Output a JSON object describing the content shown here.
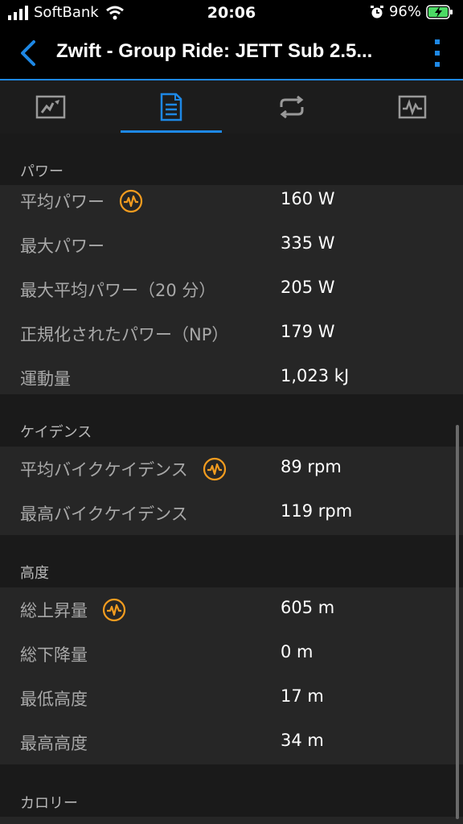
{
  "status_bar": {
    "carrier": "SoftBank",
    "time": "20:06",
    "battery_percent": "96%"
  },
  "app_bar": {
    "title": "Zwift - Group Ride: JETT Sub 2.5...",
    "back_icon": "chevron-left-icon",
    "more_icon": "more-vertical-icon"
  },
  "tabs": [
    {
      "icon": "map-icon",
      "selected": false
    },
    {
      "icon": "document-list-icon",
      "selected": true
    },
    {
      "icon": "repeat-icon",
      "selected": false
    },
    {
      "icon": "chart-icon",
      "selected": false
    }
  ],
  "sections": {
    "power": {
      "header": "パワー",
      "rows": [
        {
          "label": "平均パワー",
          "value": "160 W",
          "icon": "pulse-icon"
        },
        {
          "label": "最大パワー",
          "value": "335 W"
        },
        {
          "label": "最大平均パワー（20 分）",
          "value": "205 W"
        },
        {
          "label": "正規化されたパワー（NP）",
          "value": "179 W"
        },
        {
          "label": "運動量",
          "value": "1,023 kJ"
        }
      ]
    },
    "cadence": {
      "header": "ケイデンス",
      "rows": [
        {
          "label": "平均バイクケイデンス",
          "value": "89 rpm",
          "icon": "pulse-icon"
        },
        {
          "label": "最高バイクケイデンス",
          "value": "119 rpm"
        }
      ]
    },
    "altitude": {
      "header": "高度",
      "rows": [
        {
          "label": "総上昇量",
          "value": "605 m",
          "icon": "pulse-icon"
        },
        {
          "label": "総下降量",
          "value": "0 m"
        },
        {
          "label": "最低高度",
          "value": "17 m"
        },
        {
          "label": "最高高度",
          "value": "34 m"
        }
      ]
    },
    "calories": {
      "header": "カロリー"
    }
  },
  "colors": {
    "accent": "#1e88e5",
    "pulse": "#f39c1f",
    "battery": "#4cd964"
  }
}
